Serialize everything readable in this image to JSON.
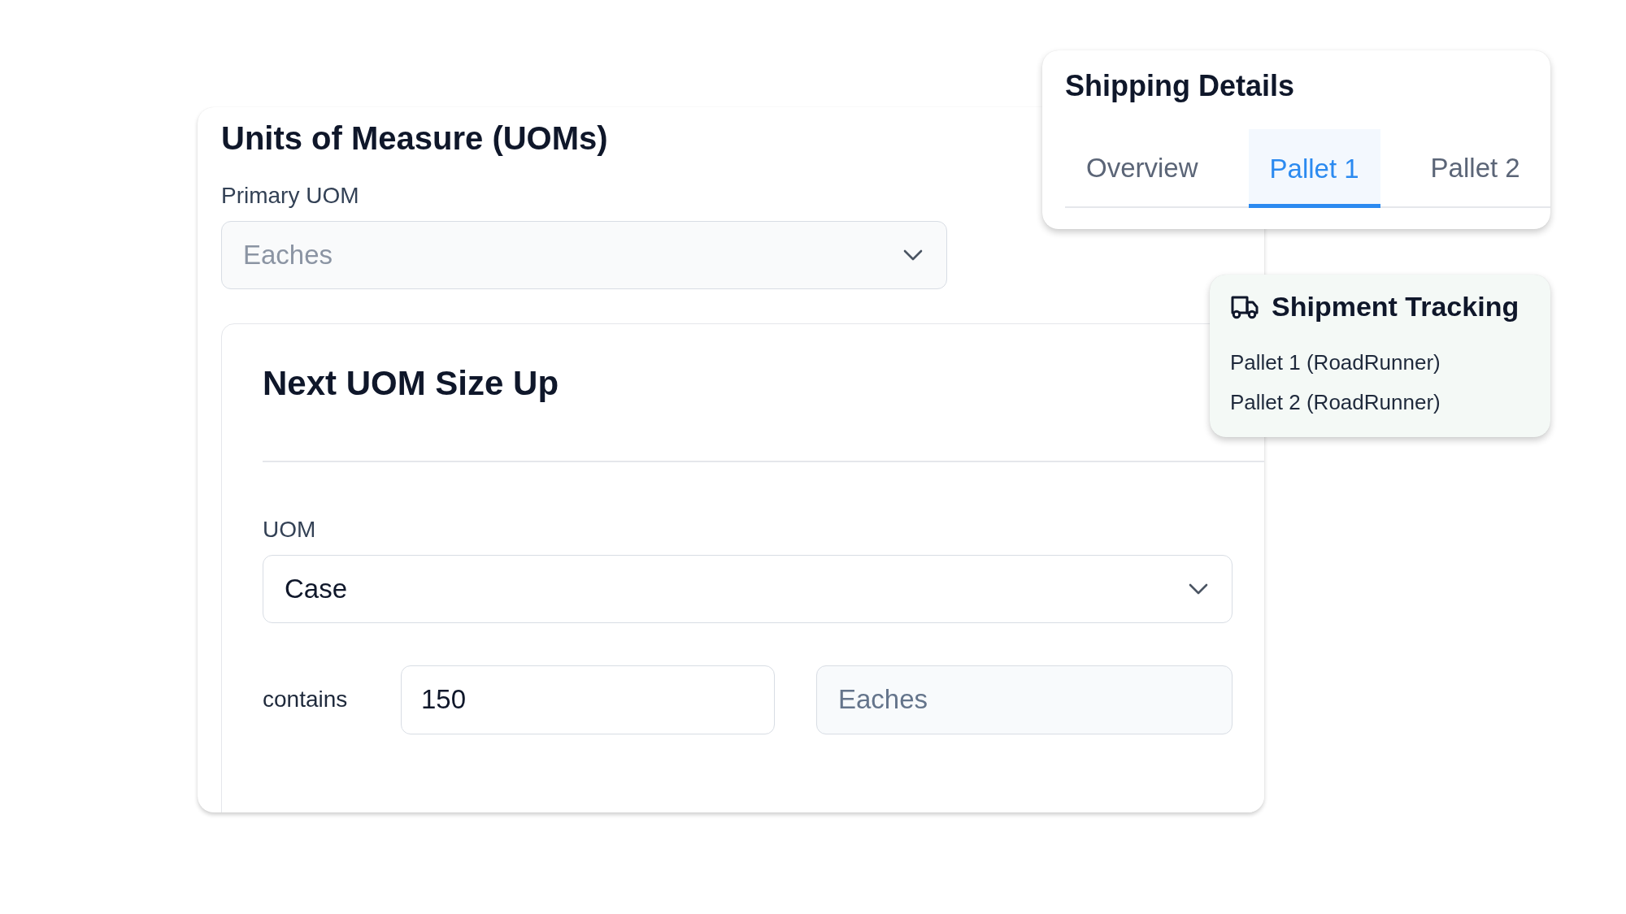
{
  "uom_panel": {
    "title": "Units of Measure (UOMs)",
    "primary_uom": {
      "label": "Primary UOM",
      "value": "Eaches",
      "disabled": true
    },
    "next_size_up": {
      "title": "Next UOM Size Up",
      "uom": {
        "label": "UOM",
        "value": "Case",
        "disabled": false
      },
      "contains": {
        "label": "contains",
        "quantity": "150",
        "unit": "Eaches"
      }
    }
  },
  "shipping_details": {
    "title": "Shipping Details",
    "tabs": [
      {
        "label": "Overview",
        "selected": false
      },
      {
        "label": "Pallet 1",
        "selected": true
      },
      {
        "label": "Pallet 2",
        "selected": false
      }
    ]
  },
  "shipment_tracking": {
    "title": "Shipment Tracking",
    "items": [
      "Pallet 1 (RoadRunner)",
      "Pallet 2 (RoadRunner)"
    ]
  }
}
